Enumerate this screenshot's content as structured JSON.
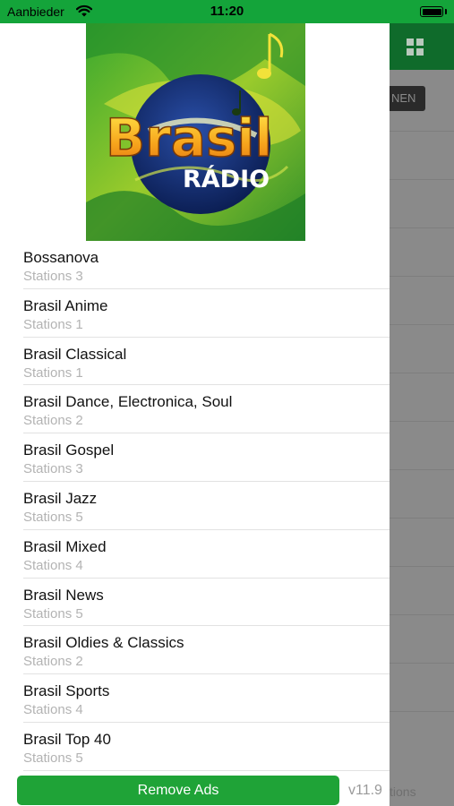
{
  "status_bar": {
    "carrier": "Aanbieder",
    "time": "11:20",
    "icons": [
      "wifi-icon",
      "battery-icon"
    ]
  },
  "logo": {
    "word_main": "Brasil",
    "word_sub": "RÁDIO",
    "icon": "music-note-icon"
  },
  "categories": [
    {
      "title": "Bossanova",
      "subtitle": "Stations 3"
    },
    {
      "title": "Brasil Anime",
      "subtitle": "Stations 1"
    },
    {
      "title": "Brasil Classical",
      "subtitle": "Stations 1"
    },
    {
      "title": "Brasil Dance, Electronica, Soul",
      "subtitle": "Stations 2"
    },
    {
      "title": "Brasil Gospel",
      "subtitle": "Stations 3"
    },
    {
      "title": "Brasil Jazz",
      "subtitle": "Stations 5"
    },
    {
      "title": "Brasil Mixed",
      "subtitle": "Stations 4"
    },
    {
      "title": "Brasil News",
      "subtitle": "Stations 5"
    },
    {
      "title": "Brasil Oldies & Classics",
      "subtitle": "Stations 2"
    },
    {
      "title": "Brasil Sports",
      "subtitle": "Stations 4"
    },
    {
      "title": "Brasil Top 40",
      "subtitle": "Stations 5"
    }
  ],
  "footer": {
    "remove_ads_label": "Remove Ads",
    "version": "v11.9"
  },
  "background_view": {
    "button_fragment": "NEN",
    "footer_fragment": "tions",
    "icon": "grid-icon"
  },
  "colors": {
    "status_bar": "#14a43a",
    "header_dimmed": "#0f6b2b",
    "button": "#1fa337"
  }
}
